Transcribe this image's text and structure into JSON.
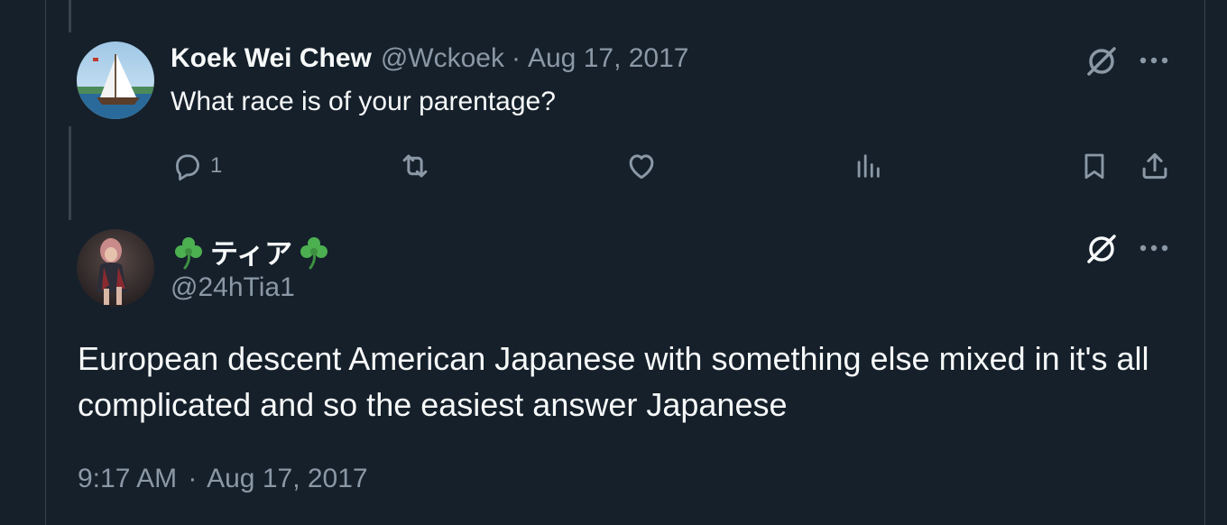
{
  "reply_tweet": {
    "display_name": "Koek Wei Chew",
    "handle": "@Wckoek",
    "separator": "·",
    "date": "Aug 17, 2017",
    "text": "What race is of your parentage?",
    "reply_count": "1",
    "avatar_icon": "sailboat-avatar",
    "actions": [
      "reply-icon",
      "retweet-icon",
      "like-icon",
      "views-icon",
      "bookmark-icon",
      "share-icon"
    ]
  },
  "main_tweet": {
    "display_name_left_emoji": "☘️",
    "display_name": "ティア",
    "display_name_right_emoji": "☘️",
    "handle": "@24hTia1",
    "text": "European descent American Japanese with something else mixed in it's all complicated and so the easiest answer Japanese",
    "time": "9:17 AM",
    "separator": "·",
    "date": "Aug 17, 2017",
    "avatar_icon": "person-avatar"
  },
  "colors": {
    "background": "#15202b",
    "text_primary": "#f7f9f9",
    "text_secondary": "#8b98a5",
    "border": "#38444d",
    "clover": "#4caf50"
  }
}
